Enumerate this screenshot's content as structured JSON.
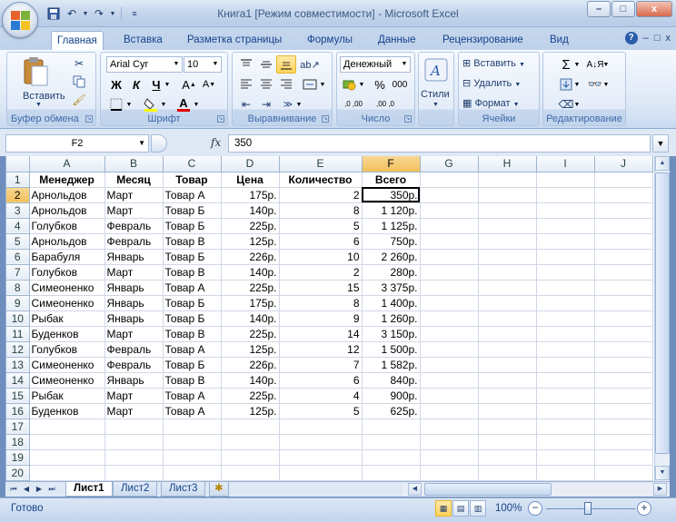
{
  "window": {
    "title": "Книга1  [Режим совместимости] - Microsoft Excel",
    "minimize": "–",
    "restore": "□",
    "close": "x"
  },
  "qat": {
    "undo": "↶",
    "redo": "↷",
    "more": "≡"
  },
  "tabs": [
    "Главная",
    "Вставка",
    "Разметка страницы",
    "Формулы",
    "Данные",
    "Рецензирование",
    "Вид"
  ],
  "ribbon": {
    "clipboard": {
      "label": "Буфер обмена",
      "paste": "Вставить"
    },
    "font": {
      "label": "Шрифт",
      "family": "Arial Cyr",
      "size": "10",
      "bold": "Ж",
      "italic": "К",
      "underline": "Ч",
      "grow": "A",
      "shrink": "A"
    },
    "alignment": {
      "label": "Выравнивание"
    },
    "number": {
      "label": "Число",
      "format": "Денежный",
      "percent": "%",
      "thousands": "000",
      "inc_decimal": ",0 ,00",
      "dec_decimal": ",00 ,0"
    },
    "styles": {
      "label": "Стили"
    },
    "cells": {
      "label": "Ячейки",
      "insert": "Вставить",
      "delete": "Удалить",
      "format": "Формат"
    },
    "editing": {
      "label": "Редактирование",
      "sum": "Σ"
    }
  },
  "formula_bar": {
    "name_box": "F2",
    "fx": "fx",
    "value": "350"
  },
  "sheet": {
    "columns": [
      "A",
      "B",
      "C",
      "D",
      "E",
      "F",
      "G",
      "H",
      "I",
      "J"
    ],
    "rows": [
      [
        "Менеджер",
        "Месяц",
        "Товар",
        "Цена",
        "Количество",
        "Всего",
        "",
        "",
        "",
        ""
      ],
      [
        "Арнольдов",
        "Март",
        "Товар А",
        "175р.",
        "2",
        "350р.",
        "",
        "",
        "",
        ""
      ],
      [
        "Арнольдов",
        "Март",
        "Товар Б",
        "140р.",
        "8",
        "1 120р.",
        "",
        "",
        "",
        ""
      ],
      [
        "Голубков",
        "Февраль",
        "Товар Б",
        "225р.",
        "5",
        "1 125р.",
        "",
        "",
        "",
        ""
      ],
      [
        "Арнольдов",
        "Февраль",
        "Товар В",
        "125р.",
        "6",
        "750р.",
        "",
        "",
        "",
        ""
      ],
      [
        "Барабуля",
        "Январь",
        "Товар Б",
        "226р.",
        "10",
        "2 260р.",
        "",
        "",
        "",
        ""
      ],
      [
        "Голубков",
        "Март",
        "Товар В",
        "140р.",
        "2",
        "280р.",
        "",
        "",
        "",
        ""
      ],
      [
        "Симеоненко",
        "Январь",
        "Товар А",
        "225р.",
        "15",
        "3 375р.",
        "",
        "",
        "",
        ""
      ],
      [
        "Симеоненко",
        "Январь",
        "Товар Б",
        "175р.",
        "8",
        "1 400р.",
        "",
        "",
        "",
        ""
      ],
      [
        "Рыбак",
        "Январь",
        "Товар Б",
        "140р.",
        "9",
        "1 260р.",
        "",
        "",
        "",
        ""
      ],
      [
        "Буденков",
        "Март",
        "Товар В",
        "225р.",
        "14",
        "3 150р.",
        "",
        "",
        "",
        ""
      ],
      [
        "Голубков",
        "Февраль",
        "Товар А",
        "125р.",
        "12",
        "1 500р.",
        "",
        "",
        "",
        ""
      ],
      [
        "Симеоненко",
        "Февраль",
        "Товар Б",
        "226р.",
        "7",
        "1 582р.",
        "",
        "",
        "",
        ""
      ],
      [
        "Симеоненко",
        "Январь",
        "Товар В",
        "140р.",
        "6",
        "840р.",
        "",
        "",
        "",
        ""
      ],
      [
        "Рыбак",
        "Март",
        "Товар А",
        "225р.",
        "4",
        "900р.",
        "",
        "",
        "",
        ""
      ],
      [
        "Буденков",
        "Март",
        "Товар А",
        "125р.",
        "5",
        "625р.",
        "",
        "",
        "",
        ""
      ],
      [
        "",
        "",
        "",
        "",
        "",
        "",
        "",
        "",
        "",
        ""
      ],
      [
        "",
        "",
        "",
        "",
        "",
        "",
        "",
        "",
        "",
        ""
      ],
      [
        "",
        "",
        "",
        "",
        "",
        "",
        "",
        "",
        "",
        ""
      ],
      [
        "",
        "",
        "",
        "",
        "",
        "",
        "",
        "",
        "",
        ""
      ]
    ],
    "active_cell": {
      "row": 2,
      "col": "F"
    }
  },
  "sheet_tabs": [
    "Лист1",
    "Лист2",
    "Лист3"
  ],
  "status": {
    "ready": "Готово",
    "zoom": "100%",
    "zoom_minus": "−",
    "zoom_plus": "+"
  }
}
